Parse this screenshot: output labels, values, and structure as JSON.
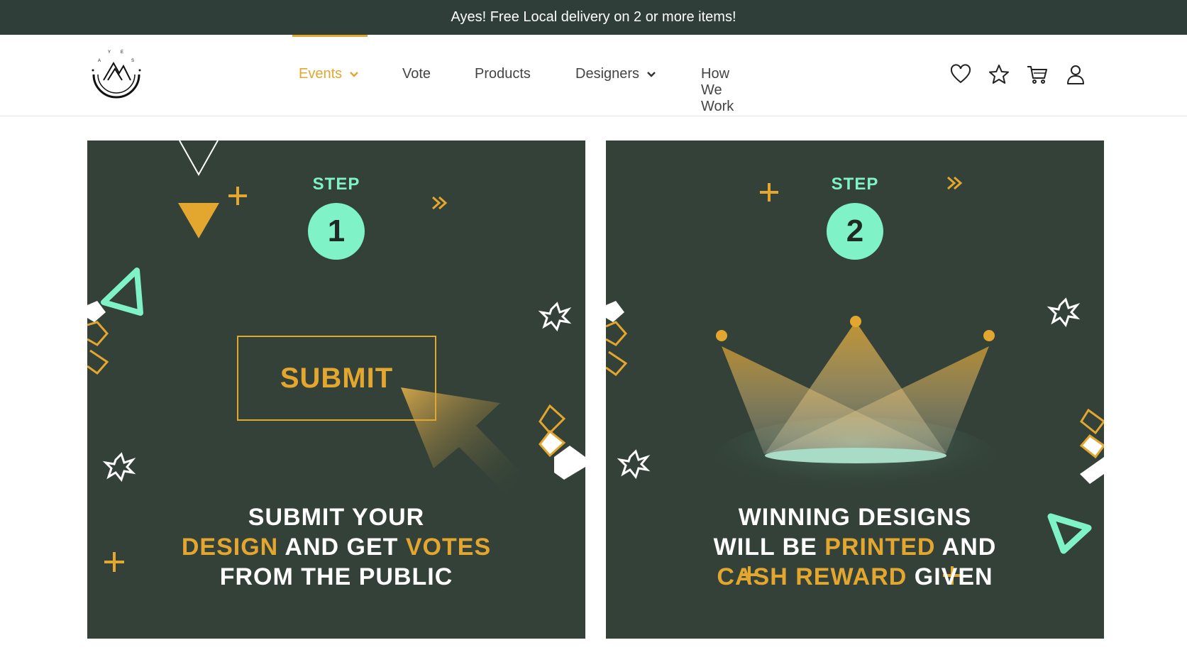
{
  "announcement": {
    "text": "Ayes! Free Local delivery on 2 or more items!"
  },
  "logo": {
    "letters": "A Y E S"
  },
  "nav": {
    "items": [
      {
        "label": "Events",
        "active": true,
        "has_dropdown": true
      },
      {
        "label": "Vote",
        "active": false,
        "has_dropdown": false
      },
      {
        "label": "Products",
        "active": false,
        "has_dropdown": false
      },
      {
        "label": "Designers",
        "active": false,
        "has_dropdown": true
      },
      {
        "label": "How We Work",
        "active": false,
        "has_dropdown": false
      }
    ]
  },
  "header_icons": [
    "heart-icon",
    "star-icon",
    "cart-icon",
    "user-icon"
  ],
  "colors": {
    "topbar": "#2f3e38",
    "card_bg": "#334138",
    "accent_gold": "#e3a62f",
    "accent_mint": "#7ff2c8",
    "text_dark": "#444444"
  },
  "steps": [
    {
      "label": "STEP",
      "number": "1",
      "button_label": "SUBMIT",
      "caption": {
        "line1": "SUBMIT YOUR",
        "line2_hl1": "DESIGN",
        "line2_mid": " AND GET ",
        "line2_hl2": "VOTES",
        "line3": "FROM THE PUBLIC"
      }
    },
    {
      "label": "STEP",
      "number": "2",
      "caption": {
        "line1": "WINNING DESIGNS",
        "line2_pre": "WILL BE ",
        "line2_hl": "PRINTED",
        "line2_post": " AND",
        "line3_hl": "CASH REWARD",
        "line3_post": " GIVEN"
      }
    }
  ]
}
